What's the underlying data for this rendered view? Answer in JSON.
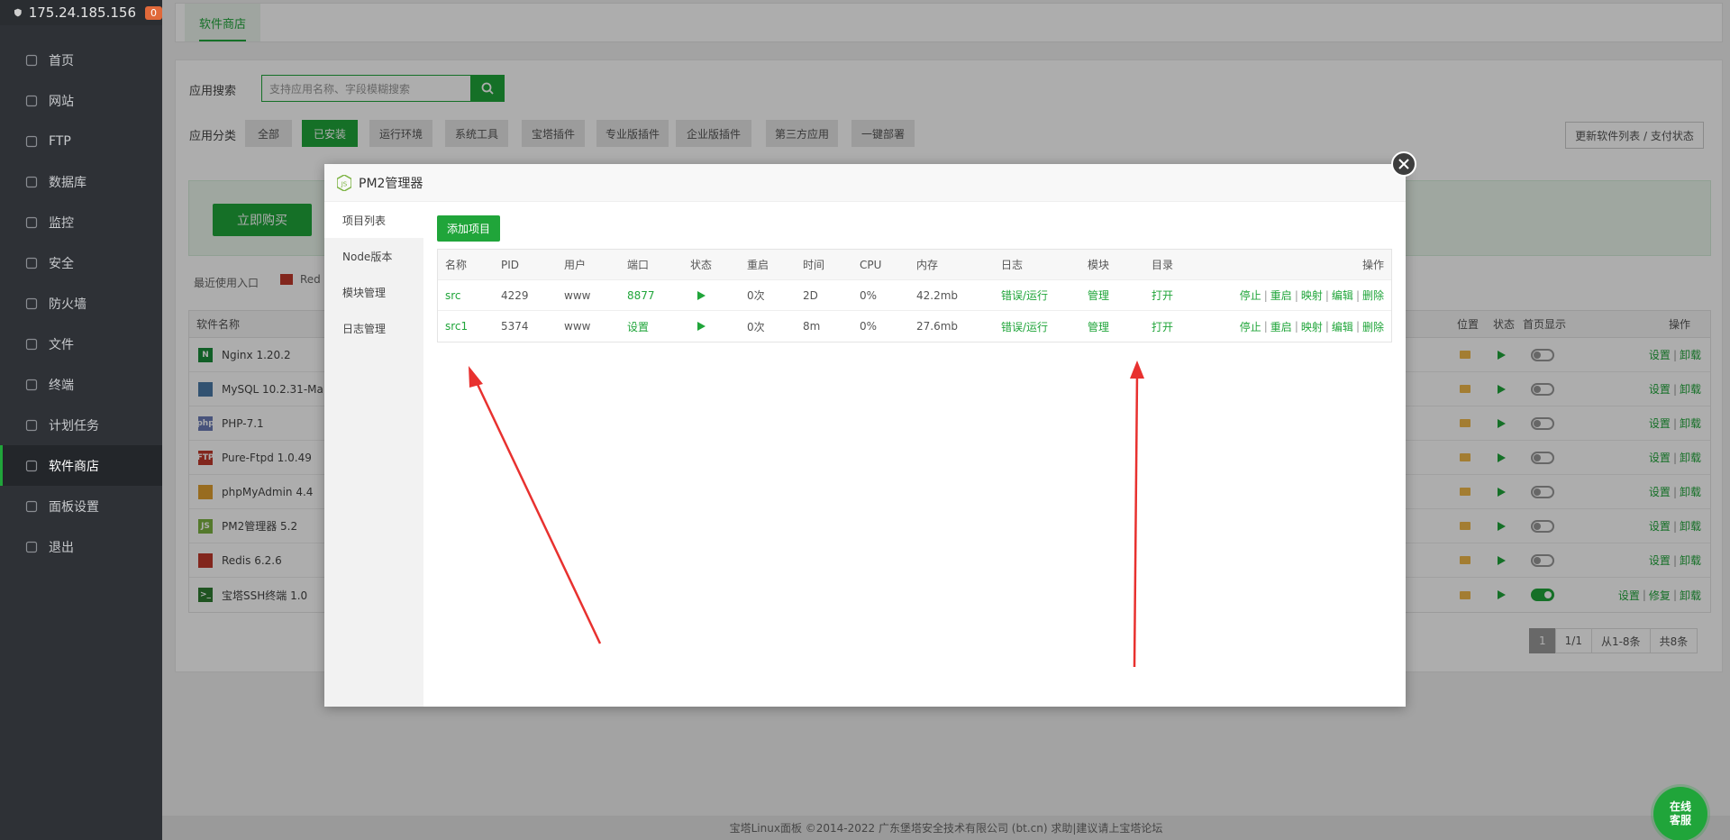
{
  "sidebar": {
    "ip": "175.24.185.156",
    "badge": "0",
    "items": [
      {
        "label": "首页",
        "icon": "home-icon"
      },
      {
        "label": "网站",
        "icon": "globe-icon"
      },
      {
        "label": "FTP",
        "icon": "ftp-icon"
      },
      {
        "label": "数据库",
        "icon": "database-icon"
      },
      {
        "label": "监控",
        "icon": "monitor-icon"
      },
      {
        "label": "安全",
        "icon": "shield-icon"
      },
      {
        "label": "防火墙",
        "icon": "firewall-icon"
      },
      {
        "label": "文件",
        "icon": "folder-icon"
      },
      {
        "label": "终端",
        "icon": "terminal-icon"
      },
      {
        "label": "计划任务",
        "icon": "calendar-icon"
      },
      {
        "label": "软件商店",
        "icon": "grid-icon"
      },
      {
        "label": "面板设置",
        "icon": "gear-icon"
      },
      {
        "label": "退出",
        "icon": "logout-icon"
      }
    ]
  },
  "tabbar": {
    "active": "软件商店"
  },
  "store": {
    "search_label": "应用搜索",
    "search_placeholder": "支持应用名称、字段模糊搜索",
    "category_label": "应用分类",
    "categories": [
      "全部",
      "已安装",
      "运行环境",
      "系统工具",
      "宝塔插件",
      "专业版插件",
      "企业版插件",
      "第三方应用",
      "一键部署"
    ],
    "update_button": "更新软件列表 / 支付状态",
    "buy_button": "立即购买",
    "recent_label": "最近使用入口",
    "recent_item": "Red",
    "table_headers": {
      "name": "软件名称",
      "position": "位置",
      "status": "状态",
      "home": "首页显示",
      "ops": "操作"
    },
    "software": [
      {
        "name": "Nginx 1.20.2",
        "icon": "nginx-icon",
        "home": false,
        "ops": [
          "设置",
          "卸载"
        ]
      },
      {
        "name": "MySQL 10.2.31-Ma",
        "icon": "mysql-icon",
        "home": false,
        "ops": [
          "设置",
          "卸载"
        ]
      },
      {
        "name": "PHP-7.1",
        "icon": "php-icon",
        "home": false,
        "ops": [
          "设置",
          "卸载"
        ]
      },
      {
        "name": "Pure-Ftpd 1.0.49",
        "icon": "ftp-icon",
        "home": false,
        "ops": [
          "设置",
          "卸载"
        ]
      },
      {
        "name": "phpMyAdmin 4.4",
        "icon": "phpmyadmin-icon",
        "home": false,
        "ops": [
          "设置",
          "卸载"
        ]
      },
      {
        "name": "PM2管理器 5.2",
        "icon": "nodejs-icon",
        "home": false,
        "ops": [
          "设置",
          "卸载"
        ]
      },
      {
        "name": "Redis 6.2.6",
        "icon": "redis-icon",
        "home": false,
        "ops": [
          "设置",
          "卸载"
        ]
      },
      {
        "name": "宝塔SSH终端 1.0",
        "icon": "terminal-icon",
        "home": true,
        "ops": [
          "设置",
          "修复",
          "卸载"
        ]
      }
    ],
    "pager": {
      "current": "1",
      "pages": "1/1",
      "range": "从1-8条",
      "total": "共8条"
    }
  },
  "modal": {
    "title": "PM2管理器",
    "side_items": [
      "项目列表",
      "Node版本",
      "模块管理",
      "日志管理"
    ],
    "add_button": "添加项目",
    "headers": [
      "名称",
      "PID",
      "用户",
      "端口",
      "状态",
      "重启",
      "时间",
      "CPU",
      "内存",
      "日志",
      "模块",
      "目录",
      "操作"
    ],
    "projects": [
      {
        "name": "src",
        "pid": "4229",
        "user": "www",
        "port": "8877",
        "restart": "0次",
        "time": "2D",
        "cpu": "0%",
        "mem": "42.2mb",
        "log": "错误/运行",
        "module": "管理",
        "dir": "打开",
        "ops": [
          "停止",
          "重启",
          "映射",
          "编辑",
          "删除"
        ]
      },
      {
        "name": "src1",
        "pid": "5374",
        "user": "www",
        "port": "设置",
        "restart": "0次",
        "time": "8m",
        "cpu": "0%",
        "mem": "27.6mb",
        "log": "错误/运行",
        "module": "管理",
        "dir": "打开",
        "ops": [
          "停止",
          "重启",
          "映射",
          "编辑",
          "删除"
        ]
      }
    ]
  },
  "footer": {
    "text": "宝塔Linux面板 ©2014-2022 广东堡塔安全技术有限公司 (bt.cn)   求助|建议请上宝塔论坛"
  },
  "chat": {
    "line1": "在线",
    "line2": "客服"
  },
  "colors": {
    "accent": "#20a53a",
    "sidebar": "#2e3136",
    "arrow": "#e8312f"
  }
}
